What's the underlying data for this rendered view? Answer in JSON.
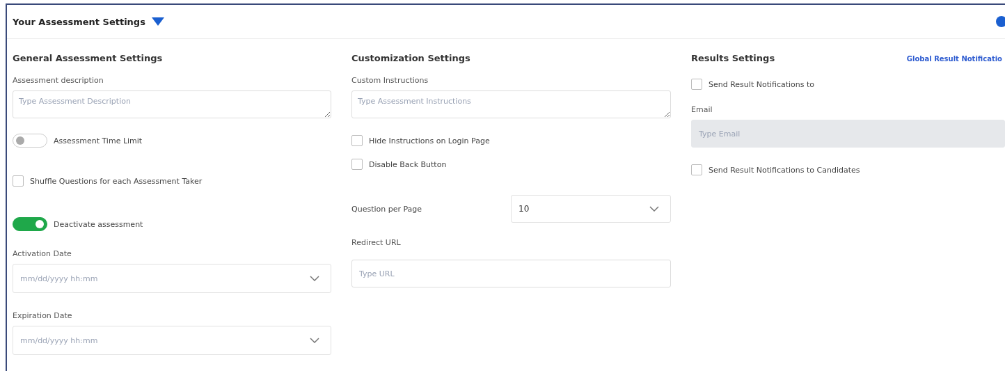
{
  "header": {
    "title": "Your Assessment Settings",
    "expanded": true
  },
  "general": {
    "title": "General Assessment Settings",
    "description": {
      "label": "Assessment description",
      "placeholder": "Type Assessment Description"
    },
    "time_limit": {
      "label": "Assessment Time Limit",
      "on": false
    },
    "shuffle": {
      "label": "Shuffle Questions for each Assessment Taker",
      "checked": false
    },
    "deactivate": {
      "label": "Deactivate assessment",
      "on": true
    },
    "activation": {
      "label": "Activation Date",
      "placeholder": "mm/dd/yyyy hh:mm"
    },
    "expiration": {
      "label": "Expiration Date",
      "placeholder": "mm/dd/yyyy hh:mm"
    }
  },
  "customization": {
    "title": "Customization Settings",
    "instructions": {
      "label": "Custom Instructions",
      "placeholder": "Type Assessment Instructions"
    },
    "checkboxes": [
      {
        "label": "Hide Instructions on Login Page",
        "checked": false
      },
      {
        "label": "Disable Back Button",
        "checked": false
      }
    ],
    "per_page": {
      "label": "Question per Page",
      "value": "10"
    },
    "redirect": {
      "label": "Redirect URL",
      "placeholder": "Type URL"
    }
  },
  "results": {
    "title": "Results Settings",
    "link": "Global Result Notificatio",
    "send_to": {
      "label": "Send Result Notifications to",
      "checked": false
    },
    "email": {
      "label": "Email",
      "placeholder": "Type Email",
      "disabled": true
    },
    "candidates": {
      "label": "Send Result Notifications to Candidates",
      "checked": false
    }
  }
}
